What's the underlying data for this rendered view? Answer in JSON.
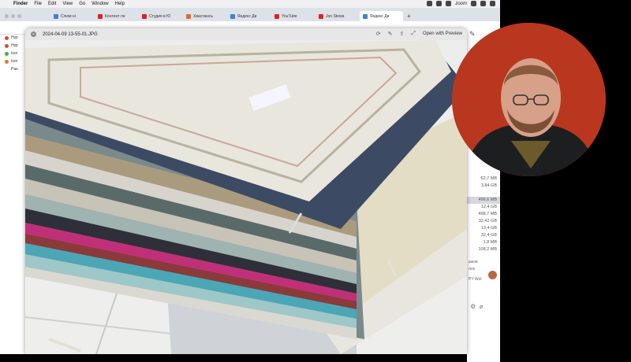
{
  "menubar": {
    "items": [
      "Finder",
      "File",
      "Edit",
      "View",
      "Go",
      "Window",
      "Help"
    ],
    "zoom_label": "zoom"
  },
  "tabs": [
    {
      "label": "Січом ні",
      "fav": "#4a7bd6"
    },
    {
      "label": "Контент ле",
      "fav": "#e02020"
    },
    {
      "label": "Студия в Ю",
      "fav": "#e02020"
    },
    {
      "label": "Хвастаюсь",
      "fav": "#e86a2a"
    },
    {
      "label": "Яндекс Ди",
      "fav": "#3b82d8"
    },
    {
      "label": "YouTube",
      "fav": "#e02020"
    },
    {
      "label": "Jon Stewa",
      "fav": "#e02020"
    },
    {
      "label": "Яндекс Ди",
      "fav": "#3b82d8",
      "active": true
    }
  ],
  "sidebar": {
    "items": [
      {
        "label": "Нур",
        "color": "#d84a3a"
      },
      {
        "label": "Нур",
        "color": "#d84a3a"
      },
      {
        "label": "Isor",
        "color": "#3fae4a"
      },
      {
        "label": "Isor",
        "color": "#e07a2a"
      },
      {
        "label": "Pas",
        "color": "transparent"
      }
    ]
  },
  "preview": {
    "filename": "2024-04-09 13-55-01.JPG",
    "open_with": "Open with Preview"
  },
  "file_sizes": [
    "62,7 MB",
    "3,84 GB",
    "...",
    "496,6 MB",
    "12,4 GB",
    "498,7 MB",
    "32,42 GB",
    "13,4 GB",
    "32,4 GB",
    "1,8 MB",
    "108,2 MB"
  ],
  "right_texts": [
    "шков",
    "лок",
    "PY Wol"
  ],
  "colors": {
    "webcam_bg": "#b9361f",
    "rug_cream": "#e9e6de",
    "rug_navy": "#3d4a63",
    "rug_magenta": "#c03078",
    "rug_teal": "#4ba6b5"
  }
}
